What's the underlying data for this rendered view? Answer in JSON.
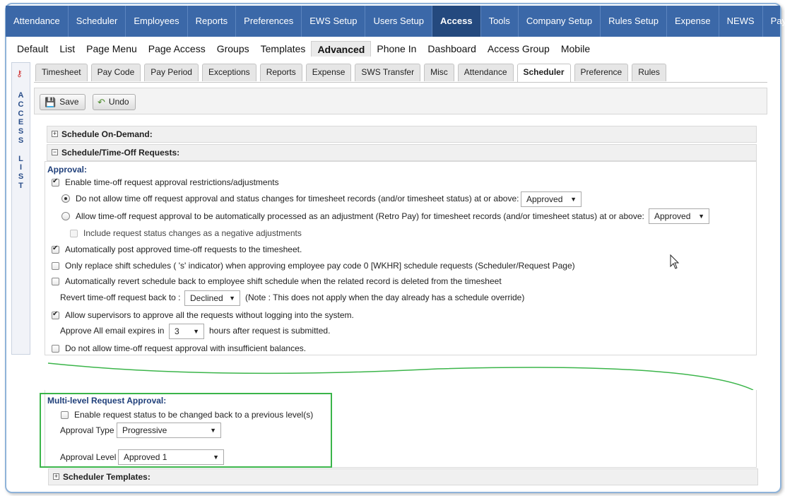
{
  "top_nav": [
    "Attendance",
    "Scheduler",
    "Employees",
    "Reports",
    "Preferences",
    "EWS Setup",
    "Users Setup",
    "Access",
    "Tools",
    "Company Setup",
    "Rules Setup",
    "Expense",
    "NEWS",
    "Payroll"
  ],
  "top_nav_active": "Access",
  "sub_nav": [
    "Default",
    "List",
    "Page Menu",
    "Page Access",
    "Groups",
    "Templates",
    "Advanced",
    "Phone In",
    "Dashboard",
    "Access Group",
    "Mobile"
  ],
  "sub_nav_active": "Advanced",
  "access_list": {
    "label": "A\nC\nC\nE\nS\nS\n\nL\nI\nS\nT",
    "icon": "key-icon"
  },
  "tabs": [
    "Timesheet",
    "Pay Code",
    "Pay Period",
    "Exceptions",
    "Reports",
    "Expense",
    "SWS Transfer",
    "Misc",
    "Attendance",
    "Scheduler",
    "Preference",
    "Rules"
  ],
  "tabs_active": "Scheduler",
  "toolbar": {
    "save_label": "Save",
    "undo_label": "Undo"
  },
  "sections": {
    "on_demand": "Schedule On-Demand:",
    "time_off": "Schedule/Time-Off Requests:",
    "templates": "Scheduler Templates:"
  },
  "approval": {
    "heading": "Approval:",
    "enable_restrictions": "Enable time-off request approval restrictions/adjustments",
    "radio_do_not_allow": "Do not allow time off request approval and status changes for timesheet records (and/or timesheet status) at or above:",
    "radio_do_not_allow_value": "Approved",
    "radio_allow_auto": "Allow time-off request approval to be automatically processed as an adjustment (Retro Pay) for timesheet records (and/or timesheet status) at or above:",
    "radio_allow_auto_value": "Approved",
    "include_negative": "Include request status changes as a negative adjustments",
    "auto_post": "Automatically post approved time-off requests to the timesheet.",
    "only_replace": "Only replace shift schedules ( 's' indicator) when approving employee pay code 0 [WKHR] schedule requests (Scheduler/Request Page)",
    "auto_revert": "Automatically revert schedule back to employee shift schedule when the related record is deleted from the timesheet",
    "revert_label": "Revert time-off request back to :",
    "revert_value": "Declined",
    "revert_note": "(Note : This does not apply when the day already has a schedule override)",
    "allow_supervisors": "Allow supervisors to approve all the requests without logging into the system.",
    "expires_prefix": "Approve All email expires in",
    "expires_value": "3",
    "expires_suffix": "hours after request is submitted.",
    "insufficient": "Do not allow time-off request approval with insufficient balances."
  },
  "multi_level": {
    "heading": "Multi-level Request Approval:",
    "enable_back": "Enable request status to be changed back to a previous level(s)",
    "type_label": "Approval Type",
    "type_value": "Progressive",
    "level_label": "Approval Level",
    "level_value": "Approved 1"
  },
  "colors": {
    "nav": "#3b68a8",
    "nav_active": "#24497e",
    "highlight": "#3bb54a"
  }
}
